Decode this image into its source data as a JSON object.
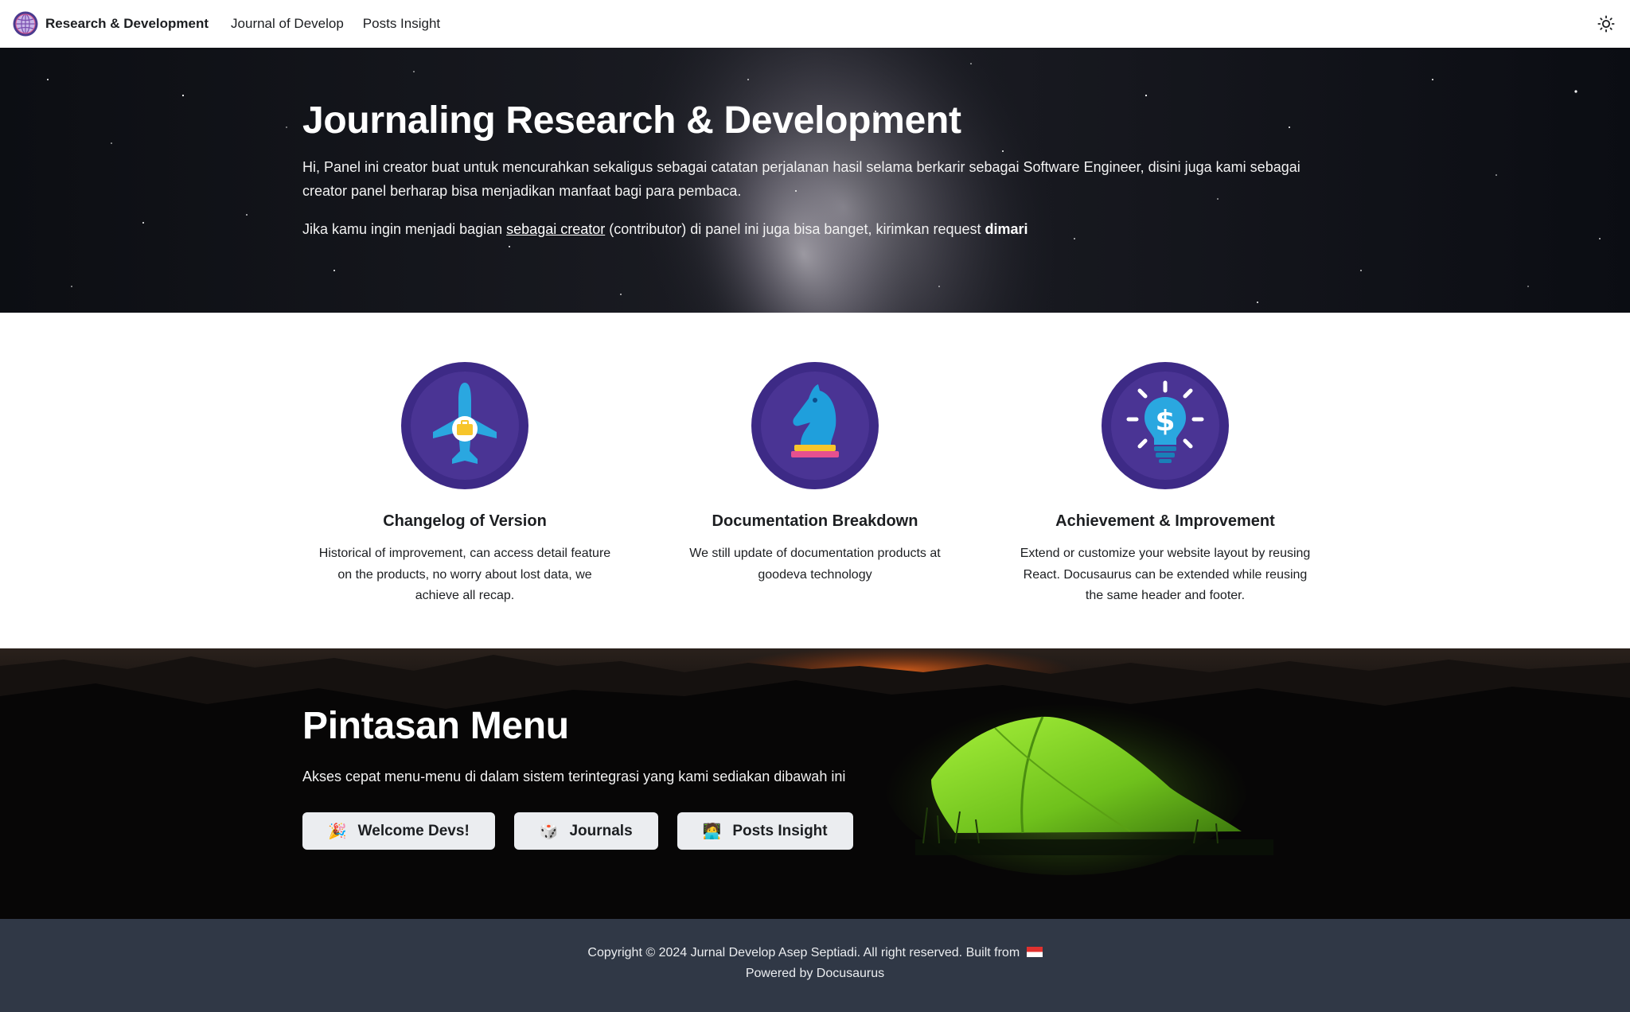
{
  "navbar": {
    "brand": "Research & Development",
    "links": [
      "Journal of Develop",
      "Posts Insight"
    ],
    "theme_toggle_icon": "sun-icon"
  },
  "hero": {
    "title": "Journaling Research & Development",
    "paragraph": "Hi, Panel ini creator buat untuk mencurahkan sekaligus sebagai catatan perjalanan hasil selama berkarir sebagai Software Engineer, disini juga kami sebagai creator panel berharap bisa menjadikan manfaat bagi para pembaca.",
    "line2_prefix": "Jika kamu ingin menjadi bagian ",
    "line2_link": "sebagai creator",
    "line2_middle": " (contributor) di panel ini juga bisa banget, kirimkan request ",
    "line2_bold": "dimari"
  },
  "features": [
    {
      "icon": "airplane-briefcase-icon",
      "title": "Changelog of Version",
      "desc": "Historical of improvement, can access detail feature on the products, no worry about lost data, we achieve all recap."
    },
    {
      "icon": "chess-knight-icon",
      "title": "Documentation Breakdown",
      "desc": "We still update of documentation products at goodeva technology"
    },
    {
      "icon": "lightbulb-dollar-icon",
      "title": "Achievement & Improvement",
      "desc": "Extend or customize your website layout by reusing React. Docusaurus can be extended while reusing the same header and footer."
    }
  ],
  "shortcut": {
    "title": "Pintasan Menu",
    "text": "Akses cepat menu-menu di dalam sistem terintegrasi yang kami sediakan dibawah ini",
    "buttons": [
      {
        "emoji": "🎉",
        "label": "Welcome Devs!"
      },
      {
        "emoji": "🎲",
        "label": "Journals"
      },
      {
        "emoji": "🧑‍💻",
        "label": "Posts Insight"
      }
    ]
  },
  "footer": {
    "copyright": "Copyright © 2024 Jurnal Develop Asep Septiadi. All right reserved. Built from",
    "powered": "Powered by Docusaurus"
  },
  "colors": {
    "feature_circle": "#3f2a82",
    "footer_bg": "#303846",
    "button_bg": "#ebedf0",
    "tent_green": "#7ed321"
  }
}
